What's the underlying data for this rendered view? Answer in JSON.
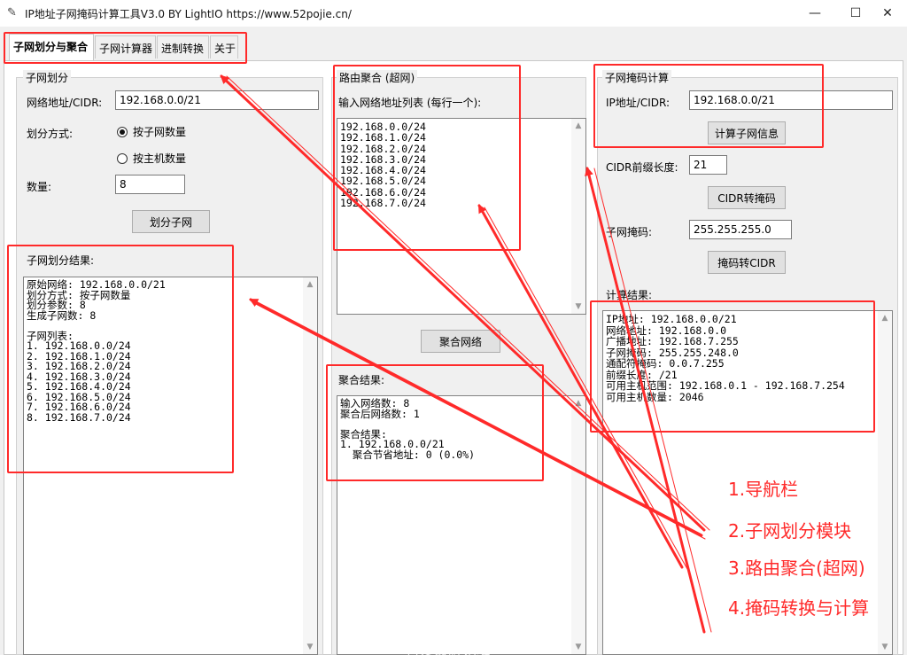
{
  "window": {
    "title": "IP地址子网掩码计算工具V3.0 BY LightIO https://www.52pojie.cn/",
    "minimize": "—",
    "maximize": "☐",
    "close": "✕"
  },
  "tabs": [
    {
      "label": "子网划分与聚合",
      "active": true
    },
    {
      "label": "子网计算器"
    },
    {
      "label": "进制转换"
    },
    {
      "label": "关于"
    }
  ],
  "subnet_division": {
    "group_title": "子网划分",
    "network_label": "网络地址/CIDR:",
    "network_value": "192.168.0.0/21",
    "method_label": "划分方式:",
    "method_by_subnets": "按子网数量",
    "method_by_hosts": "按主机数量",
    "count_label": "数量:",
    "count_value": "8",
    "divide_button": "划分子网",
    "result_title": "子网划分结果:",
    "result_text": "原始网络: 192.168.0.0/21\n划分方式: 按子网数量\n划分参数: 8\n生成子网数: 8\n\n子网列表:\n1. 192.168.0.0/24\n2. 192.168.1.0/24\n3. 192.168.2.0/24\n4. 192.168.3.0/24\n5. 192.168.4.0/24\n6. 192.168.5.0/24\n7. 192.168.6.0/24\n8. 192.168.7.0/24"
  },
  "route_aggregation": {
    "group_title": "路由聚合 (超网)",
    "input_label": "输入网络地址列表 (每行一个):",
    "input_text": "192.168.0.0/24\n192.168.1.0/24\n192.168.2.0/24\n192.168.3.0/24\n192.168.4.0/24\n192.168.5.0/24\n192.168.6.0/24\n192.168.7.0/24",
    "aggregate_button": "聚合网络",
    "result_title": "聚合结果:",
    "result_text": "输入网络数: 8\n聚合后网络数: 1\n\n聚合结果:\n1. 192.168.0.0/21\n  聚合节省地址: 0 (0.0%)"
  },
  "subnet_calc": {
    "group_title": "子网掩码计算",
    "ip_label": "IP地址/CIDR:",
    "ip_value": "192.168.0.0/21",
    "calc_button": "计算子网信息",
    "prefix_label": "CIDR前缀长度:",
    "prefix_value": "21",
    "cidr_to_mask_button": "CIDR转掩码",
    "mask_label": "子网掩码:",
    "mask_value": "255.255.255.0",
    "mask_to_cidr_button": "掩码转CIDR",
    "result_title": "计算结果:",
    "result_text": "IP地址: 192.168.0.0/21\n网络地址: 192.168.0.0\n广播地址: 192.168.7.255\n子网掩码: 255.255.248.0\n通配符掩码: 0.0.7.255\n前缀长度: /21\n可用主机范围: 192.168.0.1 - 192.168.7.254\n可用主机数量: 2046"
  },
  "annotations": {
    "items": [
      "1.导航栏",
      "2.子网划分模块",
      "3.路由聚合(超网)",
      "4.掩码转换与计算"
    ],
    "color": "#ff2a2a"
  },
  "watermark": "吾爱破解论坛"
}
